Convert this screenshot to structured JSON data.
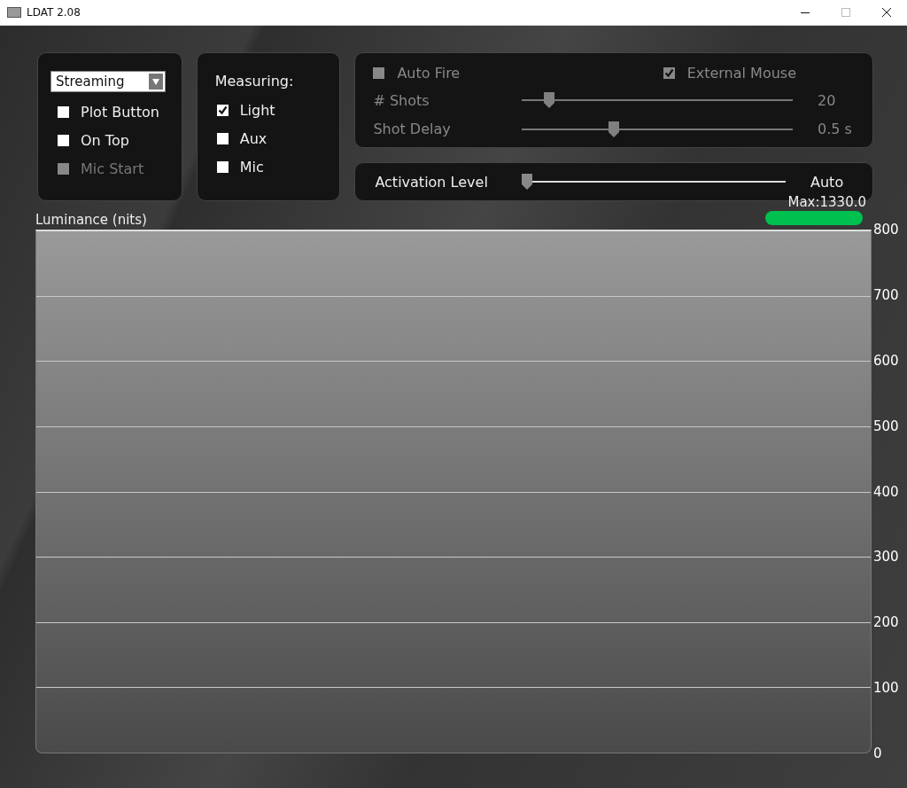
{
  "window": {
    "title": "LDAT 2.08"
  },
  "mode_panel": {
    "dropdown": {
      "value": "Streaming"
    },
    "options": [
      {
        "label": "Plot Button",
        "checked": false,
        "disabled": false
      },
      {
        "label": "On Top",
        "checked": false,
        "disabled": false
      },
      {
        "label": "Mic Start",
        "checked": false,
        "disabled": true
      }
    ]
  },
  "measuring_panel": {
    "title": "Measuring:",
    "options": [
      {
        "label": "Light",
        "checked": true
      },
      {
        "label": "Aux",
        "checked": false
      },
      {
        "label": "Mic",
        "checked": false
      }
    ]
  },
  "fire_panel": {
    "auto_fire": {
      "label": "Auto Fire",
      "checked": false,
      "disabled": true
    },
    "external_mouse": {
      "label": "External Mouse",
      "checked": true,
      "disabled": true
    },
    "sliders": [
      {
        "label": "# Shots",
        "level": 0.1,
        "reading": "20",
        "disabled": true
      },
      {
        "label": "Shot Delay",
        "level": 0.34,
        "reading": "0.5 s",
        "disabled": true
      }
    ]
  },
  "activation": {
    "label": "Activation Level",
    "level": 0.02,
    "reading": "Auto",
    "disabled": false
  },
  "chart": {
    "ylabel": "Luminance (nits)",
    "max_label": "Max:1330.0",
    "y_axis_labels": [
      "800",
      "700",
      "600",
      "500",
      "400",
      "300",
      "200",
      "100",
      "0"
    ]
  }
}
